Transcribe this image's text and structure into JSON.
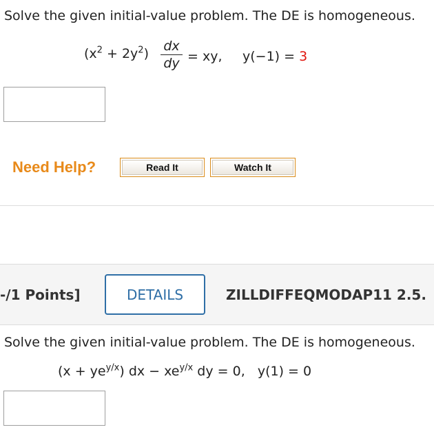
{
  "problem1": {
    "prompt": "Solve the given initial-value problem. The DE is homogeneous.",
    "eq_left": "(x² + 2y²)",
    "frac_num": "dx",
    "frac_den": "dy",
    "eq_right": "= xy,",
    "cond_prefix": "y(−1) = ",
    "cond_value": "3"
  },
  "help": {
    "label": "Need Help?",
    "read_it": "Read It",
    "watch_it": "Watch It"
  },
  "problem2": {
    "points": "-/1 Points]",
    "details": "DETAILS",
    "code": "ZILLDIFFEQMODAP11 2.5.",
    "prompt": "Solve the given initial-value problem. The DE is homogeneous.",
    "equation": "(x + ye^(y/x)) dx − xe^(y/x) dy = 0,   y(1) = 0"
  }
}
